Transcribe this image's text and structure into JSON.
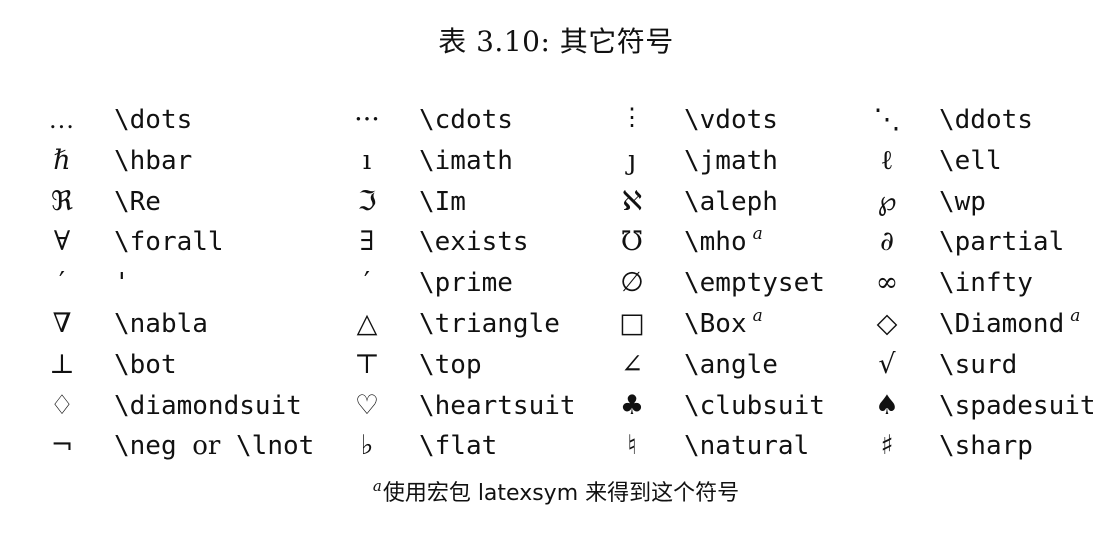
{
  "caption": "表 3.10: 其它符号",
  "columns_left": [
    0,
    305,
    570,
    825
  ],
  "rows": [
    [
      {
        "symbol": "...",
        "command": "\\dots"
      },
      {
        "symbol": "···",
        "command": "\\cdots"
      },
      {
        "symbol": "⋮",
        "command": "\\vdots"
      },
      {
        "symbol": "⋱",
        "command": "\\ddots"
      }
    ],
    [
      {
        "symbol": "ℏ",
        "command": "\\hbar"
      },
      {
        "symbol": "ı",
        "command": "\\imath"
      },
      {
        "symbol": "ȷ",
        "command": "\\jmath"
      },
      {
        "symbol": "ℓ",
        "command": "\\ell"
      }
    ],
    [
      {
        "symbol": "ℜ",
        "command": "\\Re"
      },
      {
        "symbol": "ℑ",
        "command": "\\Im"
      },
      {
        "symbol": "ℵ",
        "command": "\\aleph"
      },
      {
        "symbol": "℘",
        "command": "\\wp"
      }
    ],
    [
      {
        "symbol": "∀",
        "command": "\\forall"
      },
      {
        "symbol": "∃",
        "command": "\\exists"
      },
      {
        "symbol": "℧",
        "command": "\\mho",
        "note": "a"
      },
      {
        "symbol": "∂",
        "command": "\\partial"
      }
    ],
    [
      {
        "symbol": "′",
        "command": "'"
      },
      {
        "symbol": "′",
        "command": "\\prime"
      },
      {
        "symbol": "∅",
        "command": "\\emptyset"
      },
      {
        "symbol": "∞",
        "command": "\\infty"
      }
    ],
    [
      {
        "symbol": "∇",
        "command": "\\nabla"
      },
      {
        "symbol": "△",
        "command": "\\triangle"
      },
      {
        "symbol": "□",
        "command": "\\Box",
        "note": "a"
      },
      {
        "symbol": "◇",
        "command": "\\Diamond",
        "note": "a"
      }
    ],
    [
      {
        "symbol": "⊥",
        "command": "\\bot"
      },
      {
        "symbol": "⊤",
        "command": "\\top"
      },
      {
        "symbol": "∠",
        "command": "\\angle"
      },
      {
        "symbol": "√",
        "command": "\\surd"
      }
    ],
    [
      {
        "symbol": "♢",
        "command": "\\diamondsuit"
      },
      {
        "symbol": "♡",
        "command": "\\heartsuit"
      },
      {
        "symbol": "♣",
        "command": "\\clubsuit"
      },
      {
        "symbol": "♠",
        "command": "\\spadesuit"
      }
    ],
    [
      {
        "symbol": "¬",
        "command": "\\neg",
        "or": "or",
        "alt_command": "\\lnot"
      },
      {
        "symbol": "♭",
        "command": "\\flat"
      },
      {
        "symbol": "♮",
        "command": "\\natural"
      },
      {
        "symbol": "♯",
        "command": "\\sharp"
      }
    ]
  ],
  "footnote": {
    "marker": "a",
    "text": "使用宏包 latexsym 来得到这个符号"
  }
}
